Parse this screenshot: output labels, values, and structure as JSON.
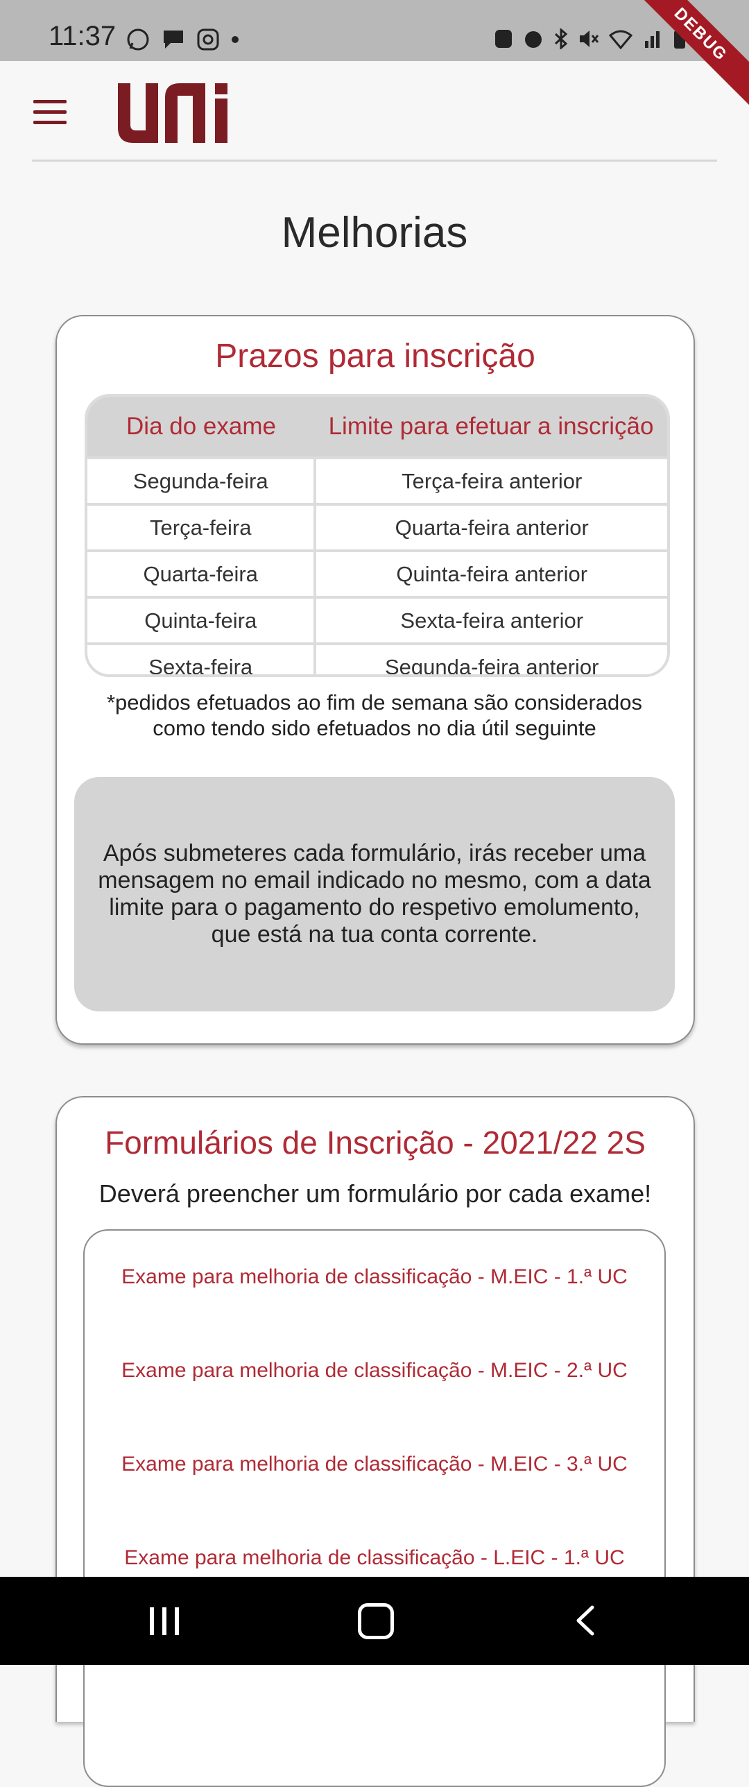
{
  "status_bar": {
    "time": "11:37",
    "debug_label": "DEBUG",
    "left_icons": [
      "whatsapp-icon",
      "message-icon",
      "instagram-icon",
      "dot-icon"
    ],
    "right_icons": [
      "nfc-icon",
      "alarm-icon",
      "bluetooth-icon",
      "mute-icon",
      "wifi-icon",
      "signal-icon",
      "battery-icon"
    ]
  },
  "header": {
    "logo_text": "uni",
    "brand_color": "#7b1c22"
  },
  "page": {
    "title": "Melhorias"
  },
  "deadlines_card": {
    "title": "Prazos para inscrição",
    "table": {
      "headers": [
        "Dia do exame",
        "Limite para efetuar a inscrição"
      ],
      "rows": [
        [
          "Segunda-feira",
          "Terça-feira anterior"
        ],
        [
          "Terça-feira",
          "Quarta-feira anterior"
        ],
        [
          "Quarta-feira",
          "Quinta-feira anterior"
        ],
        [
          "Quinta-feira",
          "Sexta-feira anterior"
        ],
        [
          "Sexta-feira",
          "Segunda-feira anterior"
        ]
      ]
    },
    "note": "*pedidos efetuados ao fim de semana são considerados como tendo sido efetuados no dia útil seguinte",
    "info": "Após submeteres cada formulário, irás receber uma mensagem no email indicado no mesmo, com a data limite para o pagamento do respetivo emolumento, que está na tua conta corrente."
  },
  "forms_card": {
    "title": "Formulários de Inscrição - 2021/22 2S",
    "subtitle": "Deverá preencher um formulário por cada exame!",
    "links": [
      "Exame para melhoria de classificação - M.EIC - 1.ª UC",
      "Exame para melhoria de classificação - M.EIC - 2.ª UC",
      "Exame para melhoria de classificação - M.EIC - 3.ª UC",
      "Exame para melhoria de classificação - L.EIC - 1.ª UC"
    ]
  },
  "colors": {
    "accent": "#b02a35",
    "table_header_bg": "#d4d4d4"
  }
}
